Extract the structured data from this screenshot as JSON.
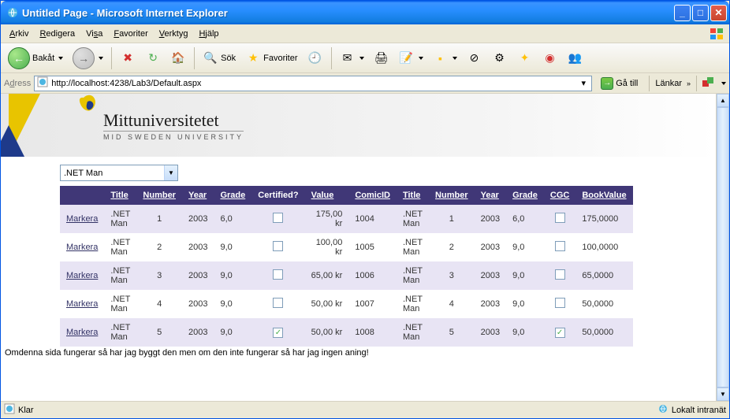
{
  "window": {
    "title": "Untitled Page - Microsoft Internet Explorer"
  },
  "menu": {
    "items": [
      "Arkiv",
      "Redigera",
      "Visa",
      "Favoriter",
      "Verktyg",
      "Hjälp"
    ]
  },
  "toolbar": {
    "back_label": "Bakåt",
    "search_label": "Sök",
    "favorites_label": "Favoriter"
  },
  "address": {
    "label": "Adress",
    "url": "http://localhost:4238/Lab3/Default.aspx",
    "go_label": "Gå till",
    "links_label": "Länkar"
  },
  "page": {
    "brand_main": "Mittuniversitetet",
    "brand_sub": "MID SWEDEN UNIVERSITY",
    "dropdown_selected": ".NET Man",
    "footer": "Omdenna sida fungerar så har jag byggt den men om den inte fungerar så har jag ingen aning!"
  },
  "table": {
    "headers": [
      "",
      "Title",
      "Number",
      "Year",
      "Grade",
      "Certified?",
      "Value",
      "ComicID",
      "Title",
      "Number",
      "Year",
      "Grade",
      "CGC",
      "BookValue"
    ],
    "select_label": "Markera",
    "rows": [
      {
        "title": ".NET Man",
        "number": "1",
        "year": "2003",
        "grade": "6,0",
        "certified": false,
        "value": "175,00 kr",
        "comicid": "1004",
        "title2": ".NET Man",
        "number2": "1",
        "year2": "2003",
        "grade2": "6,0",
        "cgc": false,
        "bookvalue": "175,0000"
      },
      {
        "title": ".NET Man",
        "number": "2",
        "year": "2003",
        "grade": "9,0",
        "certified": false,
        "value": "100,00 kr",
        "comicid": "1005",
        "title2": ".NET Man",
        "number2": "2",
        "year2": "2003",
        "grade2": "9,0",
        "cgc": false,
        "bookvalue": "100,0000"
      },
      {
        "title": ".NET Man",
        "number": "3",
        "year": "2003",
        "grade": "9,0",
        "certified": false,
        "value": "65,00 kr",
        "comicid": "1006",
        "title2": ".NET Man",
        "number2": "3",
        "year2": "2003",
        "grade2": "9,0",
        "cgc": false,
        "bookvalue": "65,0000"
      },
      {
        "title": ".NET Man",
        "number": "4",
        "year": "2003",
        "grade": "9,0",
        "certified": false,
        "value": "50,00 kr",
        "comicid": "1007",
        "title2": ".NET Man",
        "number2": "4",
        "year2": "2003",
        "grade2": "9,0",
        "cgc": false,
        "bookvalue": "50,0000"
      },
      {
        "title": ".NET Man",
        "number": "5",
        "year": "2003",
        "grade": "9,0",
        "certified": true,
        "value": "50,00 kr",
        "comicid": "1008",
        "title2": ".NET Man",
        "number2": "5",
        "year2": "2003",
        "grade2": "9,0",
        "cgc": true,
        "bookvalue": "50,0000"
      }
    ]
  },
  "status": {
    "ready": "Klar",
    "zone": "Lokalt intranät"
  }
}
